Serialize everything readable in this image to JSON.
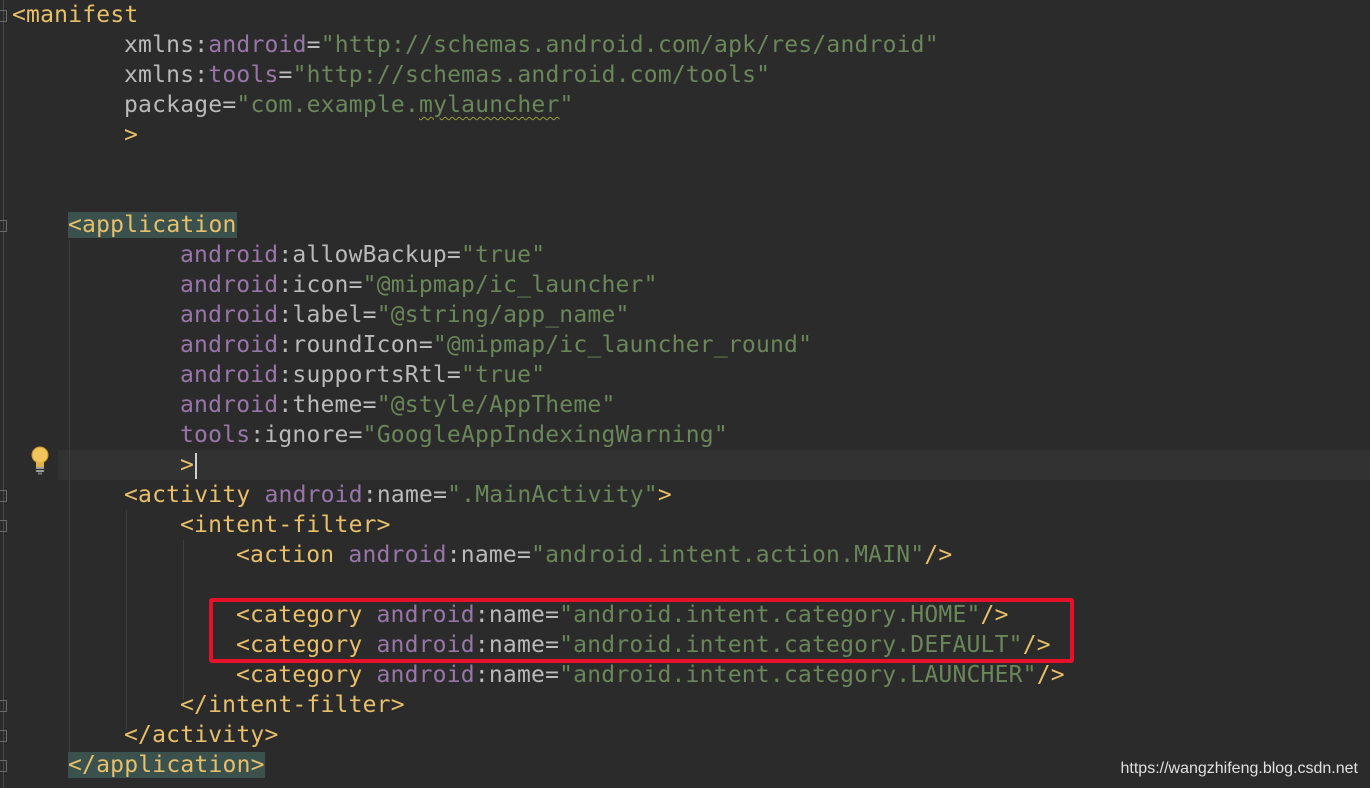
{
  "editor": {
    "lines": [
      {
        "tok": [
          [
            "tag",
            "<manifest"
          ]
        ]
      },
      {
        "tok": [
          [
            "attr",
            "xmlns:"
          ],
          [
            "ns",
            "android"
          ],
          [
            "attr",
            "="
          ],
          [
            "val",
            "\"http://schemas.android.com/apk/res/android\""
          ]
        ]
      },
      {
        "tok": [
          [
            "attr",
            "xmlns:"
          ],
          [
            "ns",
            "tools"
          ],
          [
            "attr",
            "="
          ],
          [
            "val",
            "\"http://schemas.android.com/tools\""
          ]
        ]
      },
      {
        "tok": [
          [
            "attr",
            "package="
          ],
          [
            "val",
            "\"com.example."
          ],
          [
            "val squiggle",
            "mylauncher"
          ],
          [
            "val",
            "\""
          ]
        ]
      },
      {
        "tok": [
          [
            "tag",
            ">"
          ]
        ]
      },
      {
        "tok": [
          [
            "tag tag-hl",
            "<application"
          ]
        ]
      },
      {
        "tok": [
          [
            "ns",
            "android"
          ],
          [
            "attr",
            ":allowBackup="
          ],
          [
            "val",
            "\"true\""
          ]
        ]
      },
      {
        "tok": [
          [
            "ns",
            "android"
          ],
          [
            "attr",
            ":icon="
          ],
          [
            "val",
            "\"@mipmap/ic_launcher\""
          ]
        ]
      },
      {
        "tok": [
          [
            "ns",
            "android"
          ],
          [
            "attr",
            ":label="
          ],
          [
            "val",
            "\"@string/app_name\""
          ]
        ]
      },
      {
        "tok": [
          [
            "ns",
            "android"
          ],
          [
            "attr",
            ":roundIcon="
          ],
          [
            "val",
            "\"@mipmap/ic_launcher_round\""
          ]
        ]
      },
      {
        "tok": [
          [
            "ns",
            "android"
          ],
          [
            "attr",
            ":supportsRtl="
          ],
          [
            "val",
            "\"true\""
          ]
        ]
      },
      {
        "tok": [
          [
            "ns",
            "android"
          ],
          [
            "attr",
            ":theme="
          ],
          [
            "val",
            "\"@style/AppTheme\""
          ]
        ]
      },
      {
        "tok": [
          [
            "ns",
            "tools"
          ],
          [
            "attr",
            ":ignore="
          ],
          [
            "val",
            "\"GoogleAppIndexingWarning\""
          ]
        ]
      },
      {
        "tok": [
          [
            "tag",
            ">"
          ]
        ]
      },
      {
        "tok": [
          [
            "tag",
            "<activity "
          ],
          [
            "ns",
            "android"
          ],
          [
            "attr",
            ":name="
          ],
          [
            "val",
            "\".MainActivity\""
          ],
          [
            "tag",
            ">"
          ]
        ]
      },
      {
        "tok": [
          [
            "tag",
            "<intent-filter>"
          ]
        ]
      },
      {
        "tok": [
          [
            "tag",
            "<action "
          ],
          [
            "ns",
            "android"
          ],
          [
            "attr",
            ":name="
          ],
          [
            "val",
            "\"android.intent.action.MAIN\""
          ],
          [
            "tag",
            "/>"
          ]
        ]
      },
      {
        "tok": [
          [
            "tag",
            "<category "
          ],
          [
            "ns",
            "android"
          ],
          [
            "attr",
            ":name="
          ],
          [
            "val",
            "\"android.intent.category.HOME\""
          ],
          [
            "tag",
            "/>"
          ]
        ]
      },
      {
        "tok": [
          [
            "tag",
            "<category "
          ],
          [
            "ns",
            "android"
          ],
          [
            "attr",
            ":name="
          ],
          [
            "val",
            "\"android.intent.category.DEFAULT\""
          ],
          [
            "tag",
            "/>"
          ]
        ]
      },
      {
        "tok": [
          [
            "tag",
            "<category "
          ],
          [
            "ns",
            "android"
          ],
          [
            "attr",
            ":name="
          ],
          [
            "val",
            "\"android.intent.category.LAUNCHER\""
          ],
          [
            "tag",
            "/>"
          ]
        ]
      },
      {
        "tok": [
          [
            "tag",
            "</intent-filter>"
          ]
        ]
      },
      {
        "tok": [
          [
            "tag",
            "</activity>"
          ]
        ]
      },
      {
        "tok": [
          [
            "tag tag-hl",
            "</application>"
          ]
        ]
      }
    ]
  },
  "intention_icon": "lightbulb-icon",
  "highlight_color": "#e8112c",
  "watermark": "https://wangzhifeng.blog.csdn.net"
}
